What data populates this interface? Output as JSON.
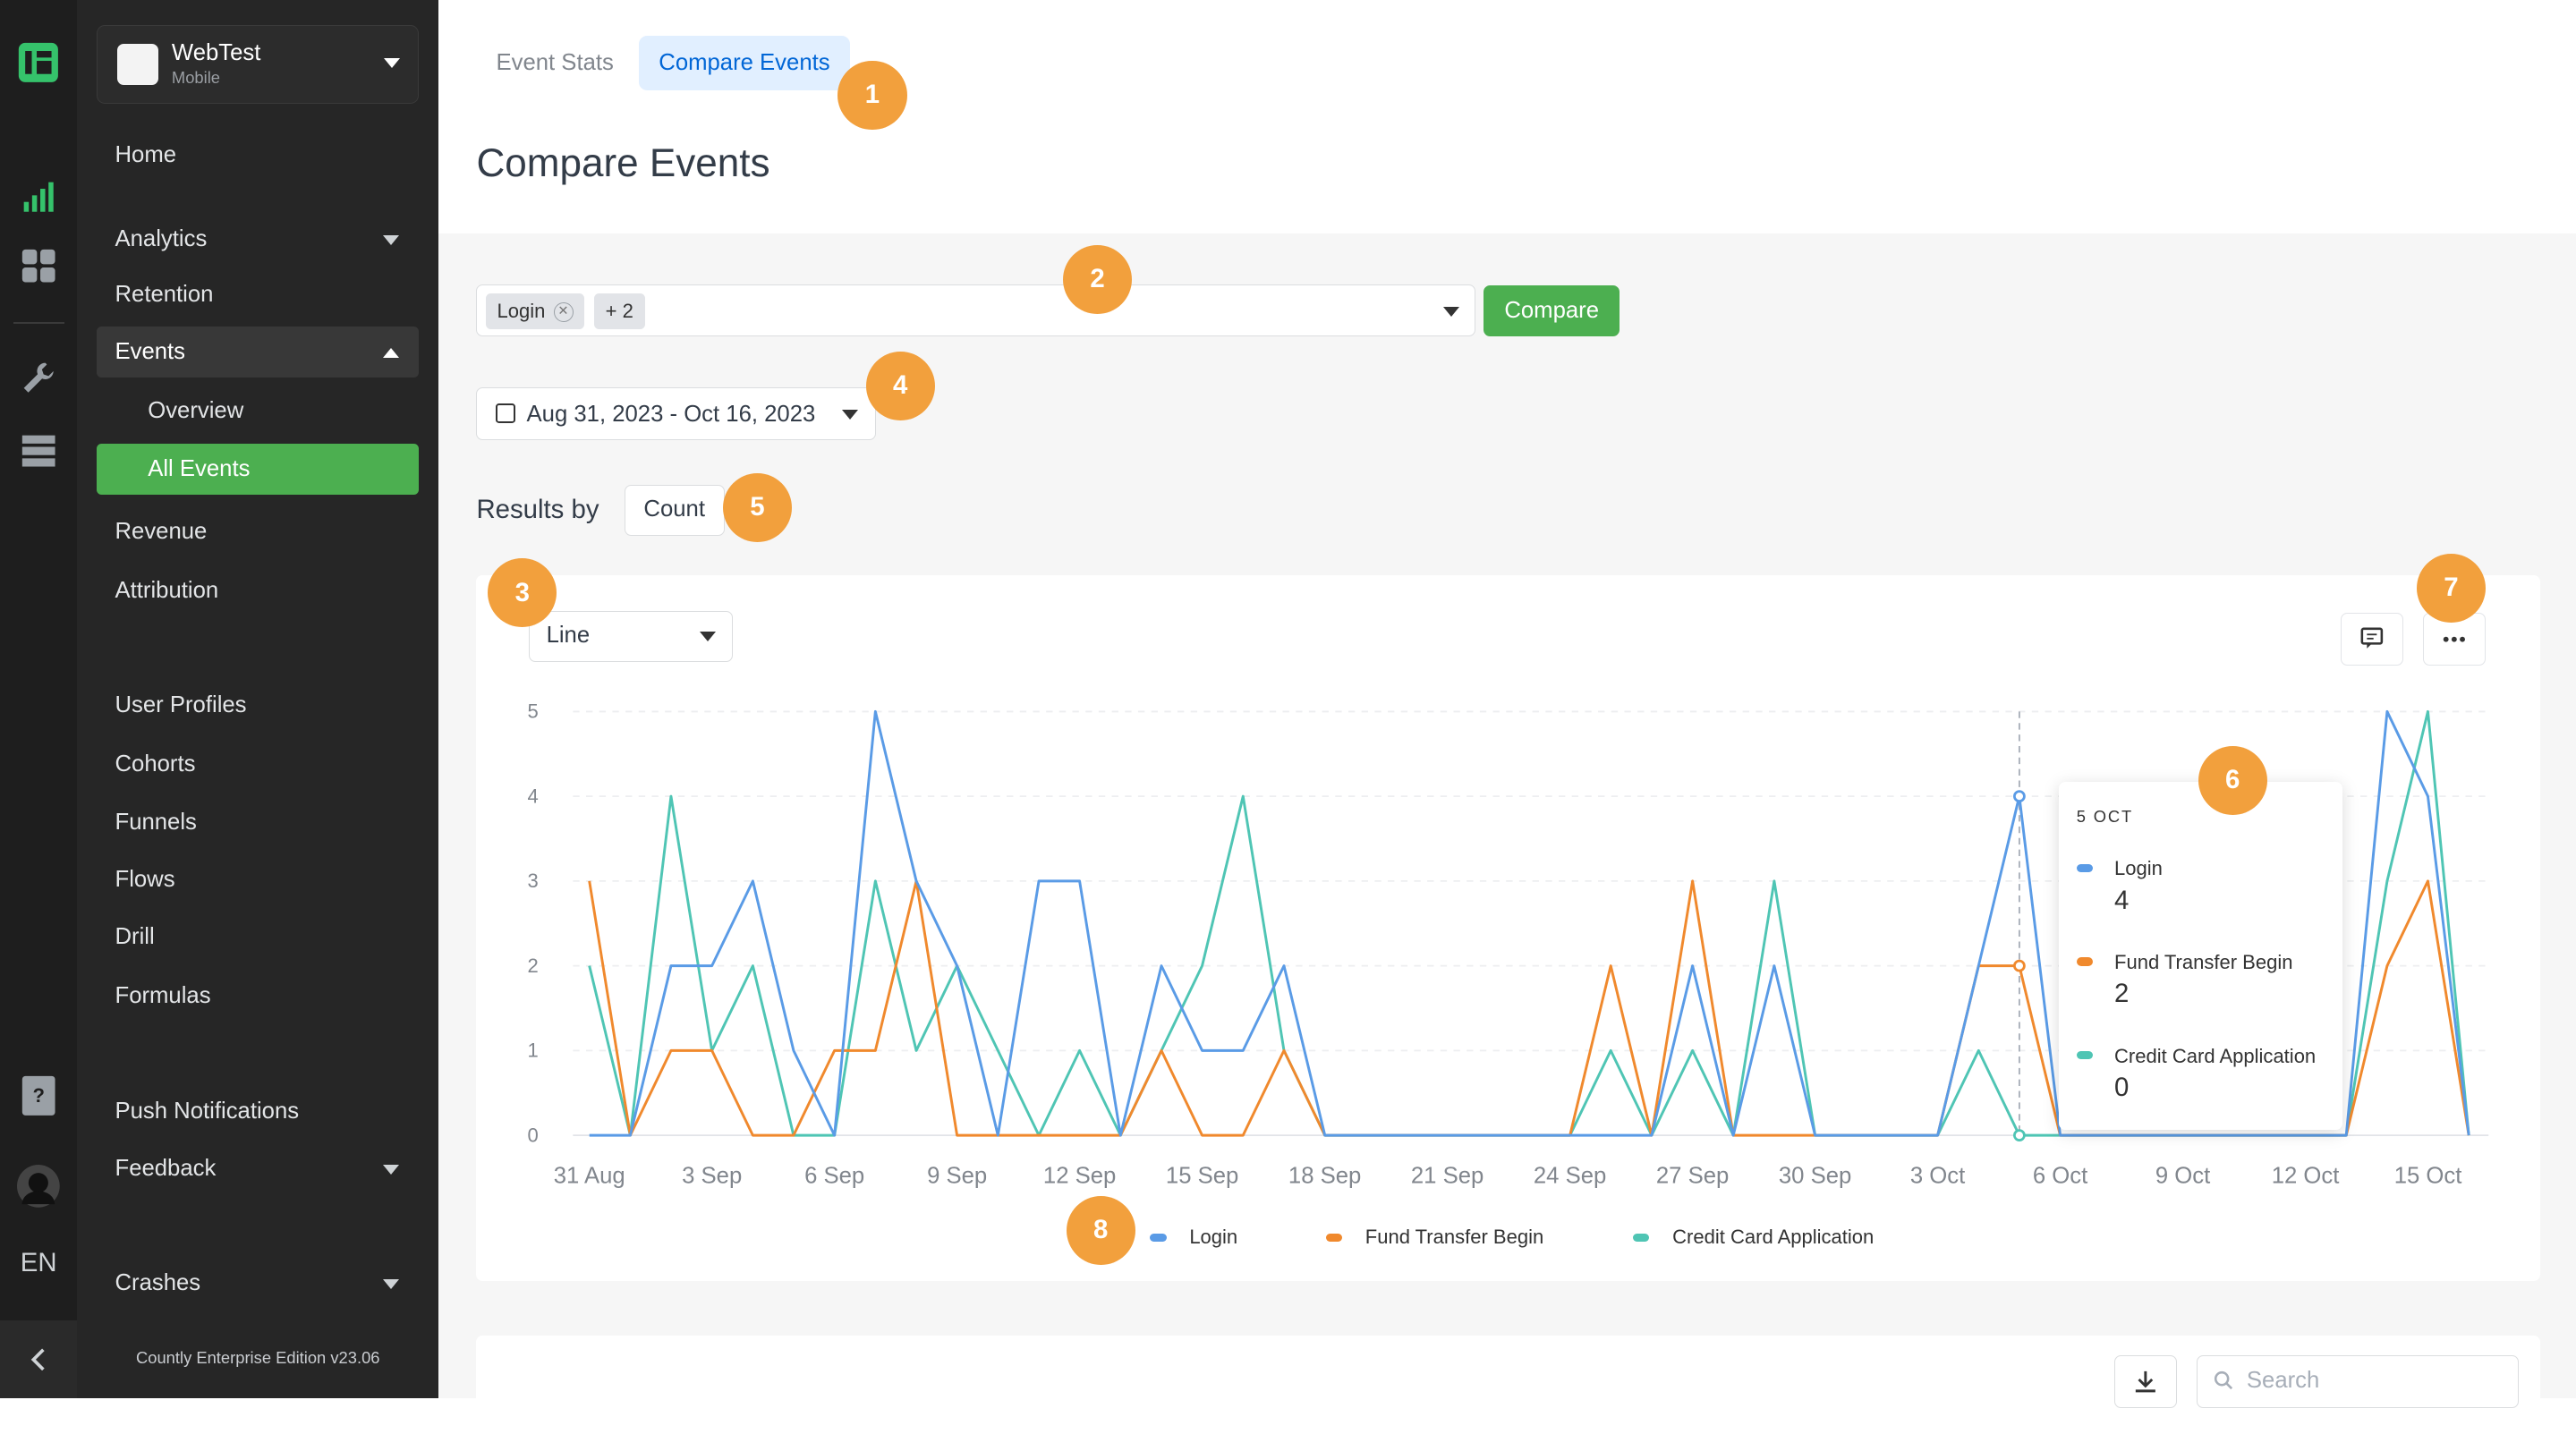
{
  "colors": {
    "login": "#5A9BE6",
    "fund_transfer": "#F0892D",
    "credit_card": "#4FC5B4",
    "accent": "#4CAF50",
    "badge": "#F2A03D"
  },
  "rail": {
    "icons": [
      "countly-logo-icon",
      "analytics-chart-icon",
      "dashboard-grid-icon",
      "wrench-icon",
      "server-icon",
      "help-document-icon",
      "user-avatar",
      "chevron-left-icon"
    ],
    "language": "EN"
  },
  "app": {
    "name": "WebTest",
    "type": "Mobile"
  },
  "sidebar": {
    "items": {
      "home": "Home",
      "analytics": "Analytics",
      "retention": "Retention",
      "events": "Events",
      "overview": "Overview",
      "all_events": "All Events",
      "revenue": "Revenue",
      "attribution": "Attribution",
      "user_profiles": "User Profiles",
      "cohorts": "Cohorts",
      "funnels": "Funnels",
      "flows": "Flows",
      "drill": "Drill",
      "formulas": "Formulas",
      "push": "Push Notifications",
      "feedback": "Feedback",
      "crashes": "Crashes"
    },
    "edition": "Countly Enterprise Edition v23.06"
  },
  "tabs": {
    "event_stats": "Event Stats",
    "compare_events": "Compare Events"
  },
  "page_title": "Compare Events",
  "event_selector": {
    "chip": "Login",
    "more": "+ 2",
    "compare_label": "Compare"
  },
  "date_range": "Aug 31, 2023 - Oct 16, 2023",
  "results": {
    "label": "Results by",
    "metric": "Count"
  },
  "chart_type_select": "Line",
  "badges": [
    "1",
    "2",
    "3",
    "4",
    "5",
    "6",
    "7",
    "8"
  ],
  "tooltip": {
    "date": "5 OCT",
    "rows": [
      {
        "name": "Login",
        "value": "4"
      },
      {
        "name": "Fund Transfer Begin",
        "value": "2"
      },
      {
        "name": "Credit Card Application",
        "value": "0"
      }
    ]
  },
  "table": {
    "search_placeholder": "Search"
  },
  "chart_data": {
    "type": "line",
    "x": [
      "31 Aug",
      "1 Sep",
      "2 Sep",
      "3 Sep",
      "4 Sep",
      "5 Sep",
      "6 Sep",
      "7 Sep",
      "8 Sep",
      "9 Sep",
      "10 Sep",
      "11 Sep",
      "12 Sep",
      "13 Sep",
      "14 Sep",
      "15 Sep",
      "16 Sep",
      "17 Sep",
      "18 Sep",
      "19 Sep",
      "20 Sep",
      "21 Sep",
      "22 Sep",
      "23 Sep",
      "24 Sep",
      "25 Sep",
      "26 Sep",
      "27 Sep",
      "28 Sep",
      "29 Sep",
      "30 Sep",
      "1 Oct",
      "2 Oct",
      "3 Oct",
      "4 Oct",
      "5 Oct",
      "6 Oct",
      "7 Oct",
      "8 Oct",
      "9 Oct",
      "10 Oct",
      "11 Oct",
      "12 Oct",
      "13 Oct",
      "14 Oct",
      "15 Oct",
      "16 Oct"
    ],
    "x_tick_labels": [
      "31 Aug",
      "3 Sep",
      "6 Sep",
      "9 Sep",
      "12 Sep",
      "15 Sep",
      "18 Sep",
      "21 Sep",
      "24 Sep",
      "27 Sep",
      "30 Sep",
      "3 Oct",
      "6 Oct",
      "9 Oct",
      "12 Oct",
      "15 Oct"
    ],
    "y_ticks": [
      0,
      1,
      2,
      3,
      4,
      5
    ],
    "ylim": [
      0,
      5
    ],
    "series": [
      {
        "name": "Login",
        "values": [
          0,
          0,
          2,
          2,
          3,
          1,
          0,
          5,
          3,
          2,
          0,
          3,
          3,
          0,
          2,
          1,
          1,
          2,
          0,
          0,
          0,
          0,
          0,
          0,
          0,
          0,
          0,
          2,
          0,
          2,
          0,
          0,
          0,
          0,
          2,
          4,
          0,
          0,
          0,
          0,
          0,
          0,
          0,
          0,
          5,
          4,
          0
        ]
      },
      {
        "name": "Fund Transfer Begin",
        "values": [
          3,
          0,
          1,
          1,
          0,
          0,
          1,
          1,
          3,
          0,
          0,
          0,
          0,
          0,
          1,
          0,
          0,
          1,
          0,
          0,
          0,
          0,
          0,
          0,
          0,
          2,
          0,
          3,
          0,
          0,
          0,
          0,
          0,
          0,
          2,
          2,
          0,
          0,
          0,
          0,
          0,
          0,
          0,
          0,
          2,
          3,
          0
        ]
      },
      {
        "name": "Credit Card Application",
        "values": [
          2,
          0,
          4,
          1,
          2,
          0,
          0,
          3,
          1,
          2,
          1,
          0,
          1,
          0,
          1,
          2,
          4,
          1,
          0,
          0,
          0,
          0,
          0,
          0,
          0,
          1,
          0,
          1,
          0,
          3,
          0,
          0,
          0,
          0,
          1,
          0,
          0,
          0,
          0,
          0,
          0,
          0,
          0,
          0,
          3,
          5,
          0
        ]
      }
    ],
    "highlight_index": 35,
    "legend": [
      "Login",
      "Fund Transfer Begin",
      "Credit Card Application"
    ],
    "grid": true
  }
}
